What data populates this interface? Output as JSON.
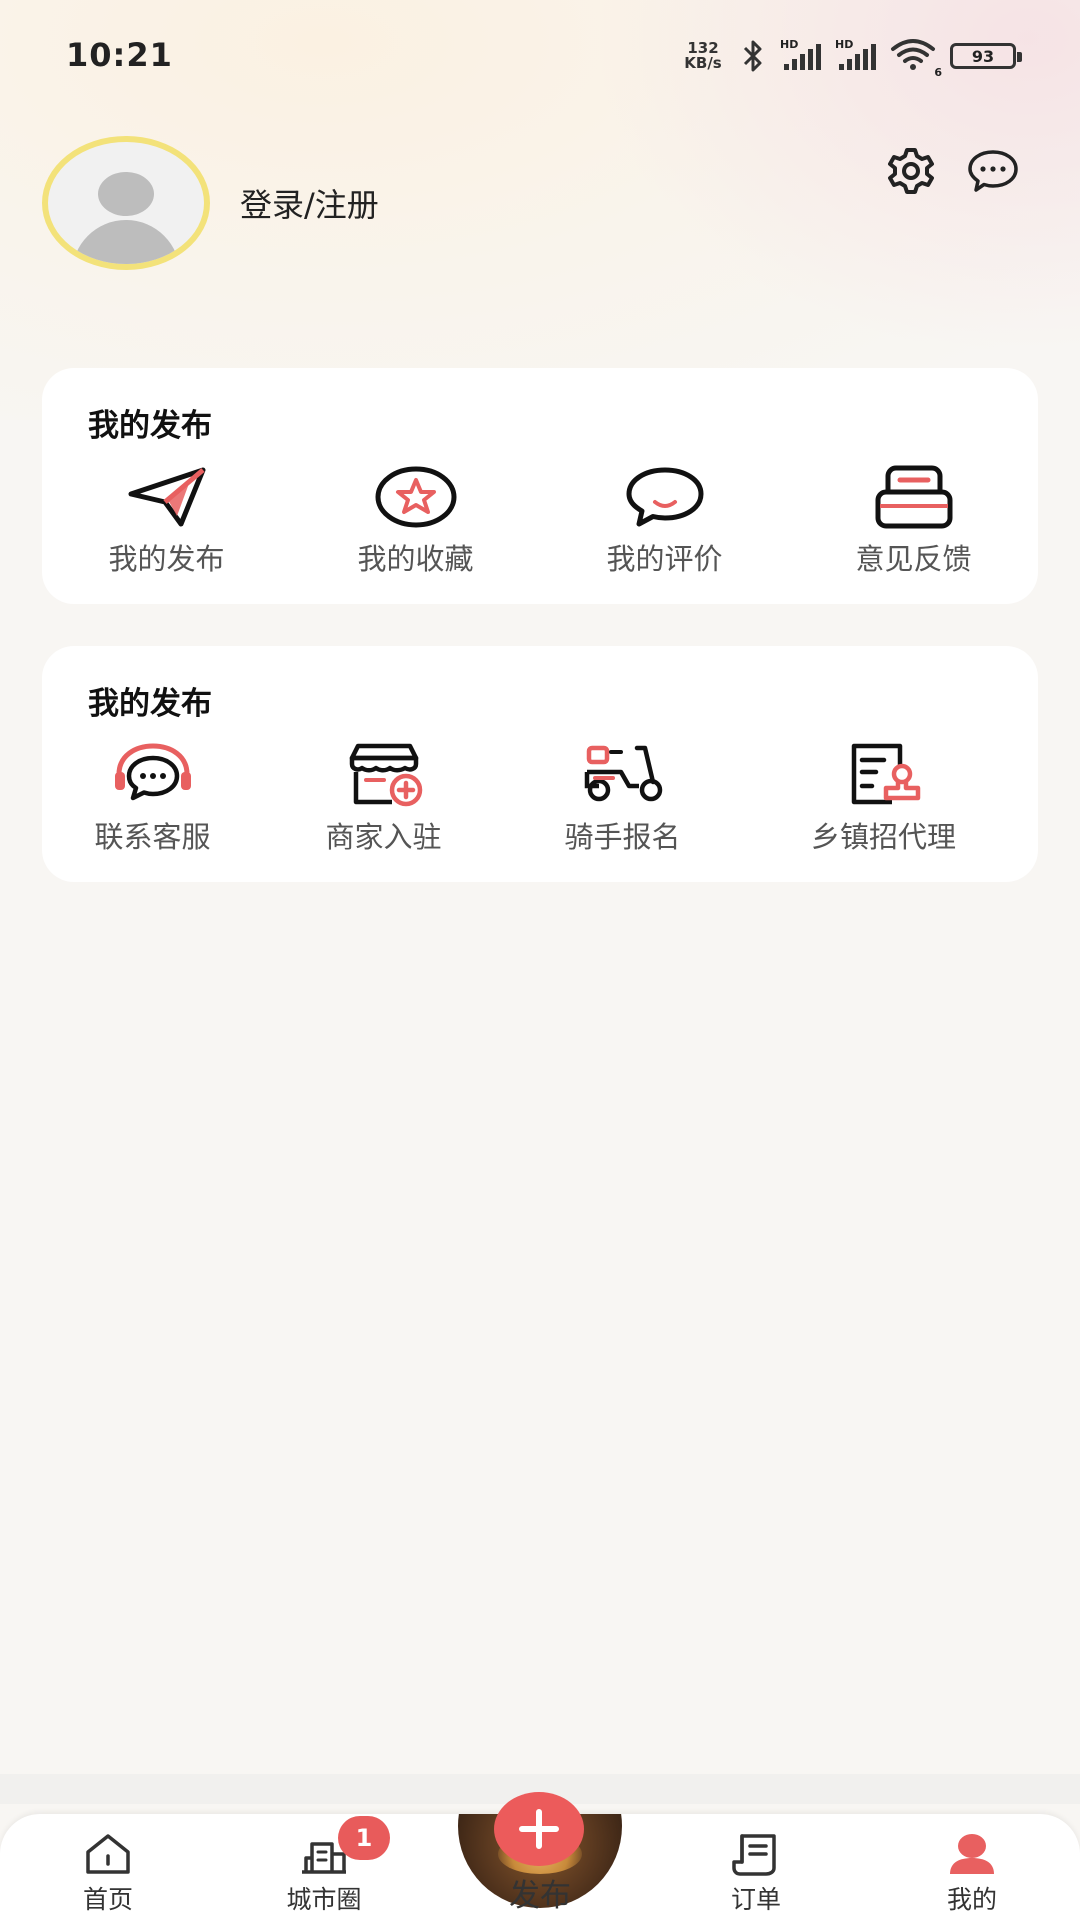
{
  "status_bar": {
    "time": "10:21",
    "net_speed_value": "132",
    "net_speed_unit": "KB/s",
    "signal_tag_1": "HD",
    "signal_tag_2": "HD",
    "wifi_tag": "6",
    "battery": "93"
  },
  "profile": {
    "login_label": "登录/注册"
  },
  "icons": {
    "settings": "gear-icon",
    "messages": "chat-bubble-icon"
  },
  "section1": {
    "title": "我的发布",
    "items": [
      {
        "label": "我的发布",
        "icon": "paper-plane-icon"
      },
      {
        "label": "我的收藏",
        "icon": "star-icon"
      },
      {
        "label": "我的评价",
        "icon": "comment-icon"
      },
      {
        "label": "意见反馈",
        "icon": "feedback-box-icon"
      }
    ]
  },
  "section2": {
    "title": "我的发布",
    "items": [
      {
        "label": "联系客服",
        "icon": "headset-icon"
      },
      {
        "label": "商家入驻",
        "icon": "store-add-icon"
      },
      {
        "label": "骑手报名",
        "icon": "scooter-icon"
      },
      {
        "label": "乡镇招代理",
        "icon": "document-stamp-icon"
      }
    ]
  },
  "nav": {
    "home": "首页",
    "city": "城市圈",
    "city_badge": "1",
    "publish": "发布",
    "orders": "订单",
    "mine": "我的"
  },
  "colors": {
    "accent": "#ec5b5b",
    "avatar_ring": "#f3e27a",
    "background": "#f8f6f3"
  }
}
